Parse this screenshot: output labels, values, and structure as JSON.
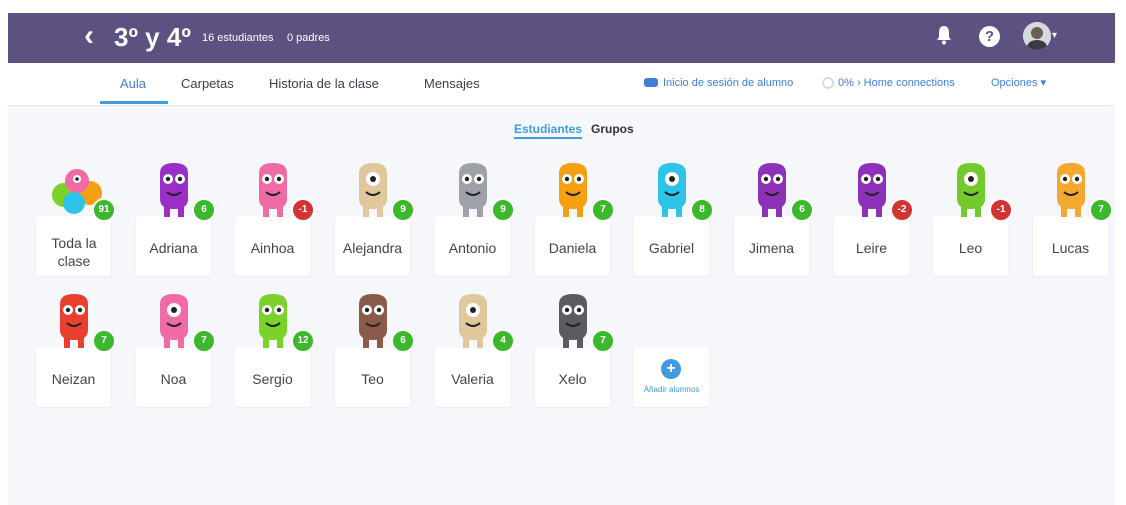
{
  "header": {
    "back_glyph": "‹",
    "class_name": "3º y 4º",
    "students_count": "16 estudiantes",
    "parents_count": "0 padres",
    "bar_color": "#5c5180"
  },
  "nav": {
    "tabs": [
      {
        "label": "Aula",
        "active": true
      },
      {
        "label": "Carpetas",
        "active": false
      },
      {
        "label": "Historia de la clase",
        "active": false
      },
      {
        "label": "Mensajes",
        "active": false
      }
    ],
    "student_login": "Inicio de sesión de alumno",
    "home_connections": "0% › Home connections",
    "options": "Opciones ▾"
  },
  "view_toggle": {
    "students": "Estudiantes",
    "groups": "Grupos"
  },
  "students": [
    {
      "name": "Toda la clase",
      "points": "91",
      "kind": "group"
    },
    {
      "name": "Adriana",
      "points": "6",
      "color": "#9a2ec7"
    },
    {
      "name": "Ainhoa",
      "points": "-1",
      "color": "#f06aa6"
    },
    {
      "name": "Alejandra",
      "points": "9",
      "color": "#e0c79c"
    },
    {
      "name": "Antonio",
      "points": "9",
      "color": "#9ea1a8"
    },
    {
      "name": "Daniela",
      "points": "7",
      "color": "#f5a012"
    },
    {
      "name": "Gabriel",
      "points": "8",
      "color": "#2ec3e8"
    },
    {
      "name": "Jimena",
      "points": "6",
      "color": "#8d32b8"
    },
    {
      "name": "Leire",
      "points": "-2",
      "color": "#8d32b8"
    },
    {
      "name": "Leo",
      "points": "-1",
      "color": "#74c92c"
    },
    {
      "name": "Lucas",
      "points": "7",
      "color": "#f5a830"
    },
    {
      "name": "Neizan",
      "points": "7",
      "color": "#e83f2f"
    },
    {
      "name": "Noa",
      "points": "7",
      "color": "#f06aa6"
    },
    {
      "name": "Sergio",
      "points": "12",
      "color": "#7cd12a"
    },
    {
      "name": "Teo",
      "points": "6",
      "color": "#8a5a4a"
    },
    {
      "name": "Valeria",
      "points": "4",
      "color": "#e0c79c"
    },
    {
      "name": "Xelo",
      "points": "7",
      "color": "#5a5b63"
    }
  ],
  "add_students": {
    "label": "Añadir alumnos",
    "icon": "plus-icon"
  },
  "colors": {
    "accent": "#3f9be0",
    "positive": "#3cb82c",
    "negative": "#d23431"
  }
}
